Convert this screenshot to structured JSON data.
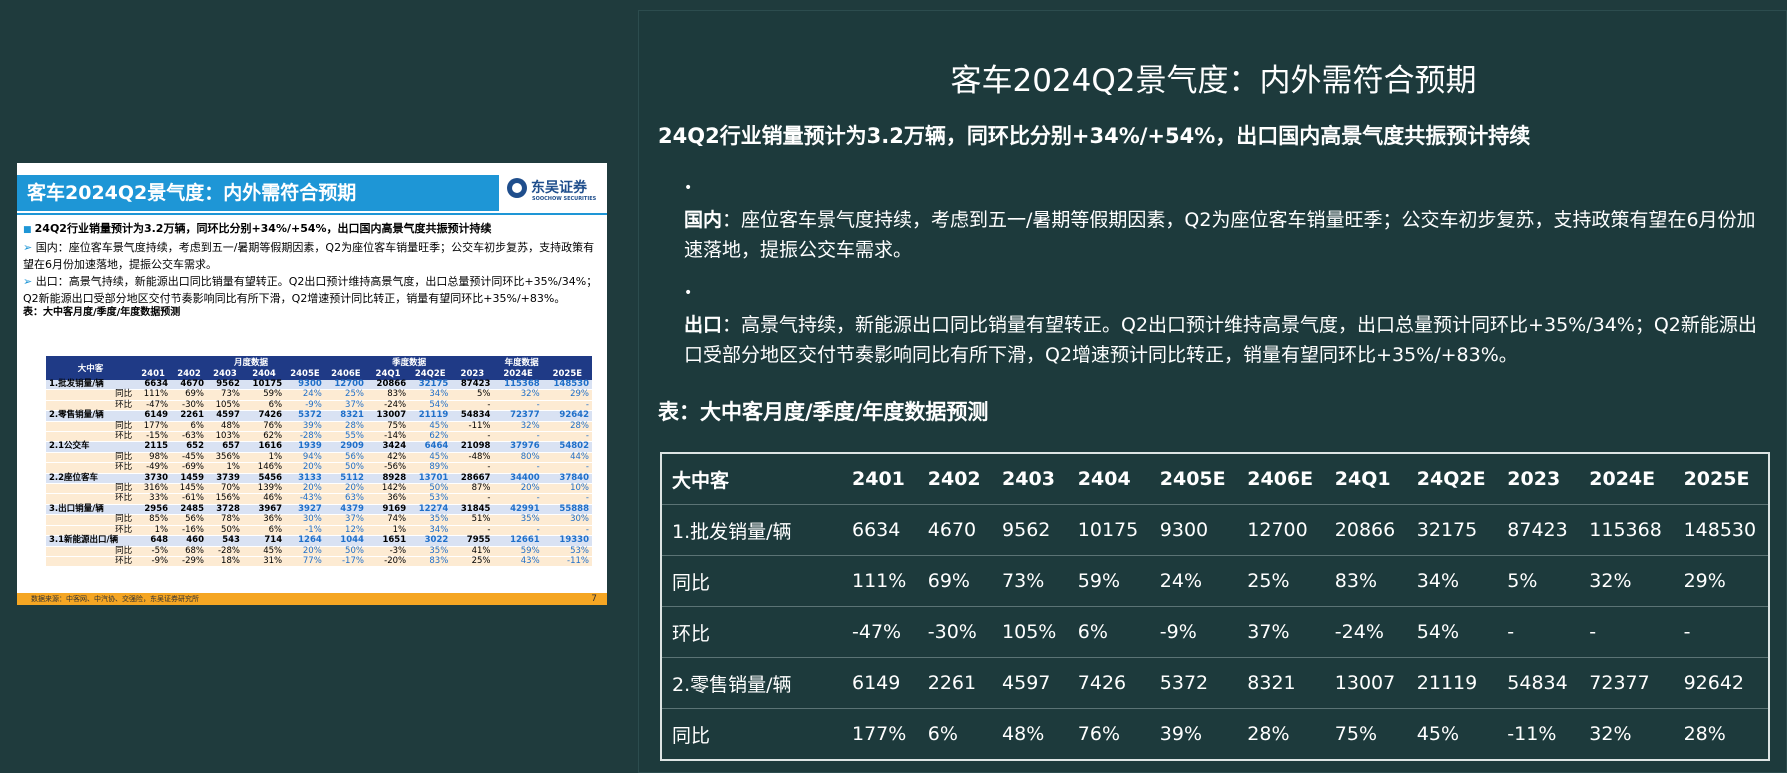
{
  "slide": {
    "header_title": "客车2024Q2景气度：内外需符合预期",
    "logo_name": "东吴证券",
    "logo_sub": "SOOCHOW SECURITIES",
    "lead": "24Q2行业销量预计为3.2万辆，同环比分别+34%/+54%，出口国内高景气度共振预计持续",
    "p1": "国内：座位客车景气度持续，考虑到五一/暑期等假期因素，Q2为座位客车销量旺季；公交车初步复苏，支持政策有望在6月份加速落地，提振公交车需求。",
    "p2": "出口：高景气持续，新能源出口同比销量有望转正。Q2出口预计维持高景气度，出口总量预计同环比+35%/34%；Q2新能源出口受部分地区交付节奏影响同比有所下滑，Q2增速预计同比转正，销量有望同环比+35%/+83%。",
    "table_caption": "表：大中客月度/季度/年度数据预测",
    "group_headers": [
      "月度数据",
      "季度数据",
      "年度数据"
    ],
    "columns": [
      "大中客",
      "2401",
      "2402",
      "2403",
      "2404",
      "2405E",
      "2406E",
      "24Q1",
      "24Q2E",
      "2023",
      "2024E",
      "2025E"
    ],
    "rows": [
      {
        "type": "hl",
        "cells": [
          "1.批发销量/辆",
          "6634",
          "4670",
          "9562",
          "10175",
          "9300",
          "12700",
          "20866",
          "32175",
          "87423",
          "115368",
          "148530"
        ]
      },
      {
        "type": "sub",
        "cells": [
          "同比",
          "111%",
          "69%",
          "73%",
          "59%",
          "24%",
          "25%",
          "83%",
          "34%",
          "5%",
          "32%",
          "29%"
        ]
      },
      {
        "type": "sub",
        "cells": [
          "环比",
          "-47%",
          "-30%",
          "105%",
          "6%",
          "-9%",
          "37%",
          "-24%",
          "54%",
          "-",
          "-",
          "-"
        ]
      },
      {
        "type": "hl",
        "cells": [
          "2.零售销量/辆",
          "6149",
          "2261",
          "4597",
          "7426",
          "5372",
          "8321",
          "13007",
          "21119",
          "54834",
          "72377",
          "92642"
        ]
      },
      {
        "type": "sub",
        "cells": [
          "同比",
          "177%",
          "6%",
          "48%",
          "76%",
          "39%",
          "28%",
          "75%",
          "45%",
          "-11%",
          "32%",
          "28%"
        ]
      },
      {
        "type": "sub",
        "cells": [
          "环比",
          "-15%",
          "-63%",
          "103%",
          "62%",
          "-28%",
          "55%",
          "-14%",
          "62%",
          "-",
          "-",
          "-"
        ]
      },
      {
        "type": "hl",
        "cells": [
          "2.1公交车",
          "2115",
          "652",
          "657",
          "1616",
          "1939",
          "2909",
          "3424",
          "6464",
          "21098",
          "37976",
          "54802"
        ]
      },
      {
        "type": "sub",
        "cells": [
          "同比",
          "98%",
          "-45%",
          "356%",
          "1%",
          "94%",
          "56%",
          "42%",
          "45%",
          "-48%",
          "80%",
          "44%"
        ]
      },
      {
        "type": "sub",
        "cells": [
          "环比",
          "-49%",
          "-69%",
          "1%",
          "146%",
          "20%",
          "50%",
          "-56%",
          "89%",
          "-",
          "-",
          "-"
        ]
      },
      {
        "type": "hl",
        "cells": [
          "2.2座位客车",
          "3730",
          "1459",
          "3739",
          "5456",
          "3133",
          "5112",
          "8928",
          "13701",
          "28667",
          "34400",
          "37840"
        ]
      },
      {
        "type": "sub",
        "cells": [
          "同比",
          "316%",
          "145%",
          "70%",
          "139%",
          "20%",
          "20%",
          "142%",
          "50%",
          "87%",
          "20%",
          "10%"
        ]
      },
      {
        "type": "sub",
        "cells": [
          "环比",
          "33%",
          "-61%",
          "156%",
          "46%",
          "-43%",
          "63%",
          "36%",
          "53%",
          "-",
          "-",
          "-"
        ]
      },
      {
        "type": "hl",
        "cells": [
          "3.出口销量/辆",
          "2956",
          "2485",
          "3728",
          "3967",
          "3927",
          "4379",
          "9169",
          "12274",
          "31845",
          "42991",
          "55888"
        ]
      },
      {
        "type": "sub",
        "cells": [
          "同比",
          "85%",
          "56%",
          "78%",
          "36%",
          "30%",
          "37%",
          "74%",
          "35%",
          "51%",
          "35%",
          "30%"
        ]
      },
      {
        "type": "sub",
        "cells": [
          "环比",
          "1%",
          "-16%",
          "50%",
          "6%",
          "-1%",
          "12%",
          "1%",
          "34%",
          "-",
          "-",
          "-"
        ]
      },
      {
        "type": "hl",
        "cells": [
          "3.1新能源出口/辆",
          "648",
          "460",
          "543",
          "714",
          "1264",
          "1044",
          "1651",
          "3022",
          "7955",
          "12661",
          "19330"
        ]
      },
      {
        "type": "sub",
        "cells": [
          "同比",
          "-5%",
          "68%",
          "-28%",
          "45%",
          "20%",
          "50%",
          "-3%",
          "35%",
          "41%",
          "59%",
          "53%"
        ]
      },
      {
        "type": "sub",
        "cells": [
          "环比",
          "-9%",
          "-29%",
          "18%",
          "31%",
          "77%",
          "-17%",
          "-20%",
          "83%",
          "25%",
          "43%",
          "-11%"
        ]
      }
    ],
    "footer_source": "数据来源：中客网、中汽协、交强险，东吴证券研究所",
    "page_no": "7"
  },
  "panel": {
    "title": "客车2024Q2景气度：内外需符合预期",
    "subtitle": "24Q2行业销量预计为3.2万辆，同环比分别+34%/+54%，出口国内高景气度共振预计持续",
    "bullets": [
      {
        "head": "国内",
        "text": "：座位客车景气度持续，考虑到五一/暑期等假期因素，Q2为座位客车销量旺季；公交车初步复苏，支持政策有望在6月份加速落地，提振公交车需求。"
      },
      {
        "head": "出口",
        "text": "：高景气持续，新能源出口同比销量有望转正。Q2出口预计维持高景气度，出口总量预计同环比+35%/34%；Q2新能源出口受部分地区交付节奏影响同比有所下滑，Q2增速预计同比转正，销量有望同环比+35%/+83%。"
      }
    ],
    "table_caption": "表：大中客月度/季度/年度数据预测",
    "table": {
      "headers": [
        "大中客",
        "2401",
        "2402",
        "2403",
        "2404",
        "2405E",
        "2406E",
        "24Q1",
        "24Q2E",
        "2023",
        "2024E",
        "2025E"
      ],
      "rows": [
        [
          "1.批发销量/辆",
          "6634",
          "4670",
          "9562",
          "10175",
          "9300",
          "12700",
          "20866",
          "32175",
          "87423",
          "115368",
          "148530"
        ],
        [
          "同比",
          "111%",
          "69%",
          "73%",
          "59%",
          "24%",
          "25%",
          "83%",
          "34%",
          "5%",
          "32%",
          "29%"
        ],
        [
          "环比",
          "-47%",
          "-30%",
          "105%",
          "6%",
          "-9%",
          "37%",
          "-24%",
          "54%",
          "-",
          "-",
          "-"
        ],
        [
          "2.零售销量/辆",
          "6149",
          "2261",
          "4597",
          "7426",
          "5372",
          "8321",
          "13007",
          "21119",
          "54834",
          "72377",
          "92642"
        ],
        [
          "同比",
          "177%",
          "6%",
          "48%",
          "76%",
          "39%",
          "28%",
          "75%",
          "45%",
          "-11%",
          "32%",
          "28%"
        ]
      ]
    }
  }
}
